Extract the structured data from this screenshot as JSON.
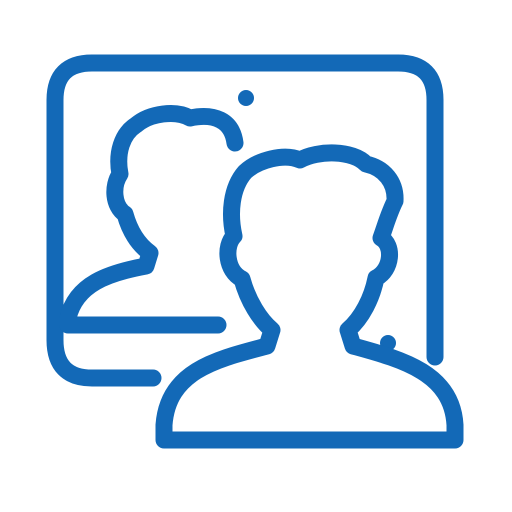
{
  "icon": {
    "name": "video-call-icon",
    "stroke_color": "#1369b7",
    "background_color": "#ffffff"
  }
}
